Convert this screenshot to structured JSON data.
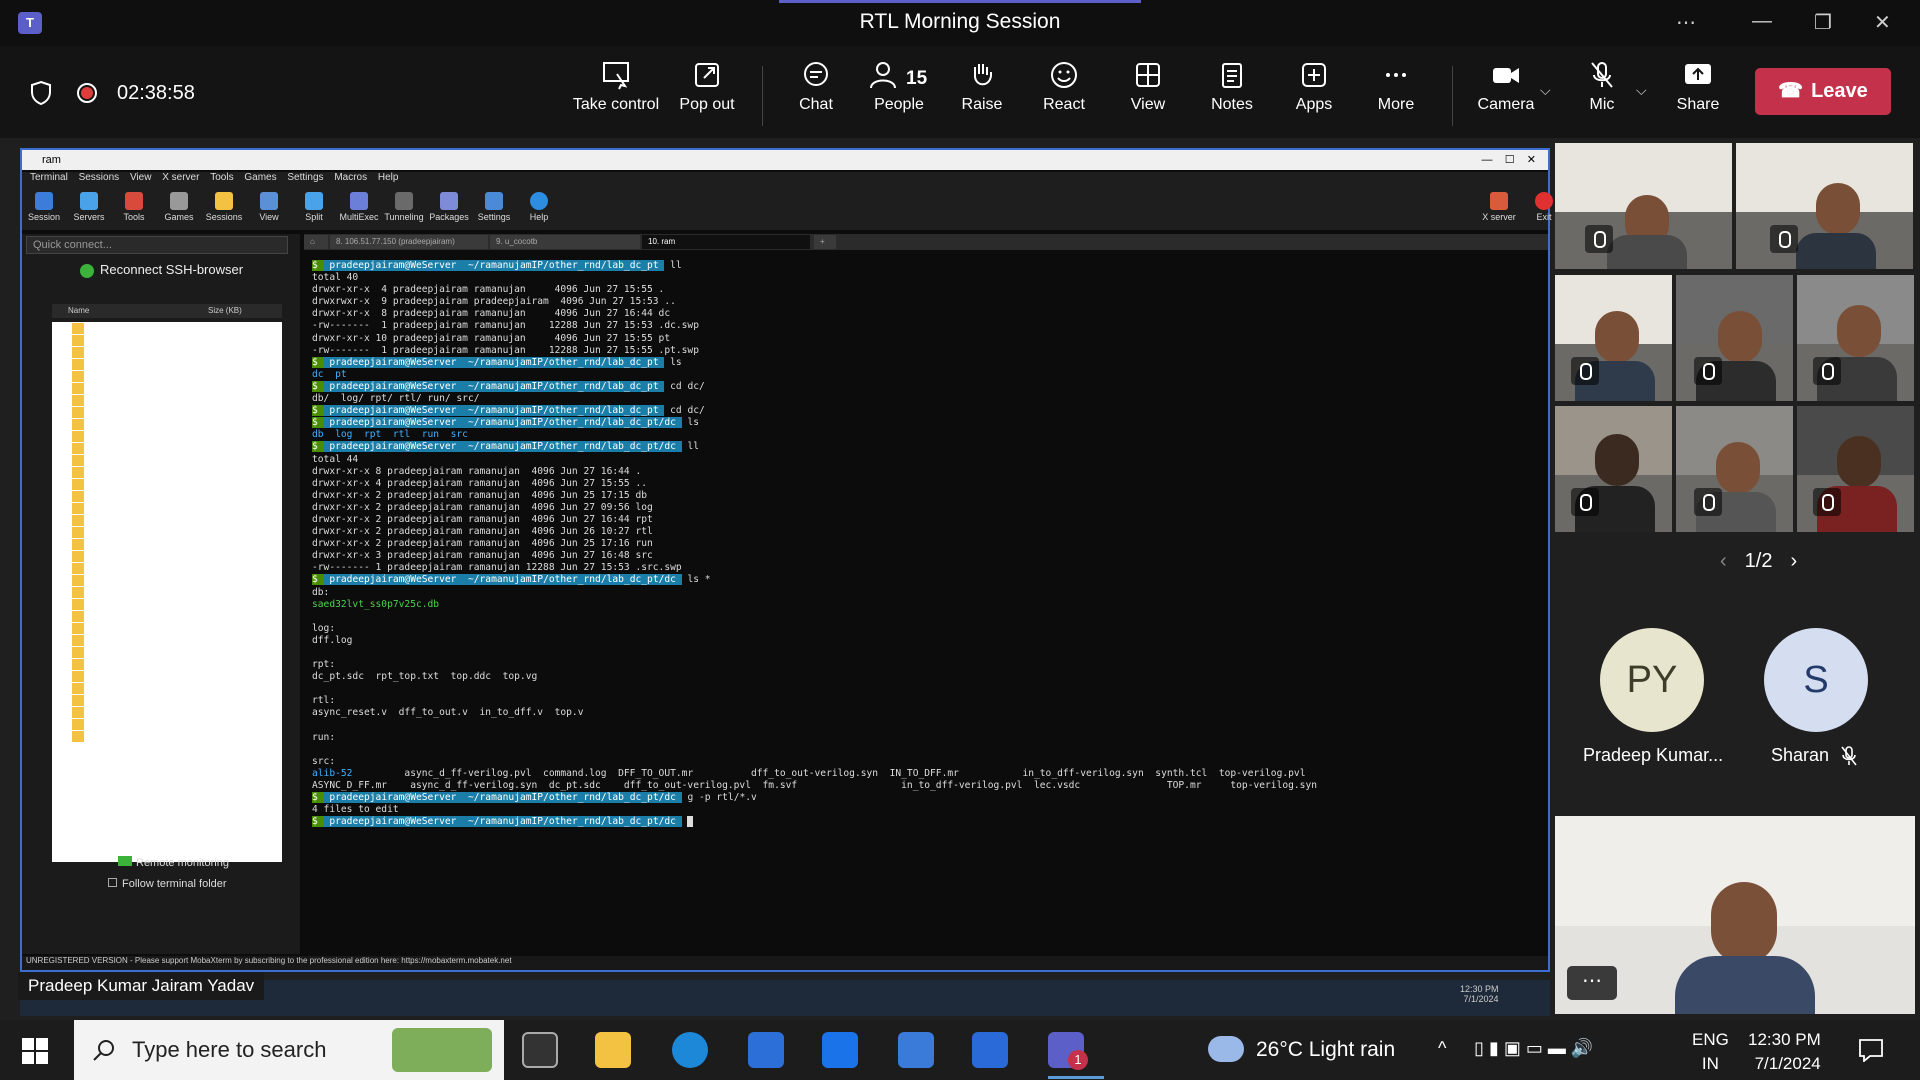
{
  "window": {
    "title": "RTL Morning Session"
  },
  "toolbar": {
    "timer": "02:38:58",
    "take_control": "Take control",
    "pop_out": "Pop out",
    "chat": "Chat",
    "people": "People",
    "people_count": "15",
    "raise": "Raise",
    "react": "React",
    "view": "View",
    "notes": "Notes",
    "apps": "Apps",
    "more": "More",
    "camera": "Camera",
    "mic": "Mic",
    "share": "Share",
    "leave": "Leave"
  },
  "shared_screen": {
    "window_title": "ram",
    "menu": [
      "Terminal",
      "Sessions",
      "View",
      "X server",
      "Tools",
      "Games",
      "Settings",
      "Macros",
      "Help"
    ],
    "tools": [
      "Session",
      "Servers",
      "Tools",
      "Games",
      "Sessions",
      "View",
      "Split",
      "MultiExec",
      "Tunneling",
      "Packages",
      "Settings",
      "Help"
    ],
    "xserver": "X server",
    "exit": "Exit",
    "quick_connect": "Quick connect...",
    "reconnect": "Reconnect SSH-browser",
    "col_name": "Name",
    "col_size": "Size (KB)",
    "remote_monitoring": "Remote monitoring",
    "follow_folder": "Follow terminal folder",
    "tabs": [
      "8. 106.51.77.150 (pradeepjairam)",
      "9. u_cocotb",
      "10. ram"
    ],
    "unregistered": "UNREGISTERED VERSION  -  Please support MobaXterm by subscribing to the professional edition here:  https://mobaxterm.mobatek.net",
    "terminal": {
      "prompt_user": "pradeepjairam@WeServer",
      "path1": "~/ramanujamIP/other_rnd/lab_dc_pt",
      "path2": "~/ramanujamIP/other_rnd/lab_dc_pt/dc",
      "cmd_ll": "ll",
      "cmd_ls": "ls",
      "cmd_cd": "cd dc/",
      "cmd_lsstar": "ls *",
      "cmd_g": "g -p rtl/*.v",
      "total40": "total 40",
      "ll1": [
        "drwxr-xr-x  4 pradeepjairam ramanujan     4096 Jun 27 15:55 .",
        "drwxrwxr-x  9 pradeepjairam pradeepjairam  4096 Jun 27 15:53 ..",
        "drwxr-xr-x  8 pradeepjairam ramanujan     4096 Jun 27 16:44 dc",
        "-rw-------  1 pradeepjairam ramanujan    12288 Jun 27 15:53 .dc.swp",
        "drwxr-xr-x 10 pradeepjairam ramanujan     4096 Jun 27 15:55 pt",
        "-rw-------  1 pradeepjairam ramanujan    12288 Jun 27 15:55 .pt.swp"
      ],
      "ls1": "dc  pt",
      "cd_out": "db/  log/ rpt/ rtl/ run/ src/",
      "ls2": "db  log  rpt  rtl  run  src",
      "total44": "total 44",
      "ll2": [
        "drwxr-xr-x 8 pradeepjairam ramanujan  4096 Jun 27 16:44 .",
        "drwxr-xr-x 4 pradeepjairam ramanujan  4096 Jun 27 15:55 ..",
        "drwxr-xr-x 2 pradeepjairam ramanujan  4096 Jun 25 17:15 db",
        "drwxr-xr-x 2 pradeepjairam ramanujan  4096 Jun 27 09:56 log",
        "drwxr-xr-x 2 pradeepjairam ramanujan  4096 Jun 27 16:44 rpt",
        "drwxr-xr-x 2 pradeepjairam ramanujan  4096 Jun 26 10:27 rtl",
        "drwxr-xr-x 2 pradeepjairam ramanujan  4096 Jun 25 17:16 run",
        "drwxr-xr-x 3 pradeepjairam ramanujan  4096 Jun 27 16:48 src",
        "-rw------- 1 pradeepjairam ramanujan 12288 Jun 27 15:53 .src.swp"
      ],
      "db_h": "db:",
      "db_f": "saed32lvt_ss0p7v25c.db",
      "log_h": "log:",
      "log_f": "dff.log",
      "rpt_h": "rpt:",
      "rpt_f": "dc_pt.sdc  rpt_top.txt  top.ddc  top.vg",
      "rtl_h": "rtl:",
      "rtl_f": "async_reset.v  dff_to_out.v  in_to_dff.v  top.v",
      "run_h": "run:",
      "src_h": "src:",
      "src_1a": "alib-52",
      "src_1b": "         async_d_ff-verilog.pvl  command.log  DFF_TO_OUT.mr          dff_to_out-verilog.syn  IN_TO_DFF.mr           in_to_dff-verilog.syn  synth.tcl  top-verilog.pvl",
      "src_2": "ASYNC_D_FF.mr    async_d_ff-verilog.syn  dc_pt.sdc    dff_to_out-verilog.pvl  fm.svf                  in_to_dff-verilog.pvl  lec.vsdc               TOP.mr     top-verilog.syn",
      "g_out": "4 files to edit"
    }
  },
  "presenter_name": "Pradeep Kumar Jairam Yadav",
  "pager": "1/2",
  "participants": [
    {
      "initials": "PY",
      "name": "Pradeep Kumar...",
      "color": "#e8e5cf",
      "text_color": "#3d3d2a"
    },
    {
      "initials": "S",
      "name": "Sharan",
      "color": "#d4def0",
      "text_color": "#243a6a"
    }
  ],
  "taskbar": {
    "search_placeholder": "Type here to search",
    "weather": "26°C  Light rain",
    "lang1": "ENG",
    "lang2": "IN",
    "time": "12:30 PM",
    "date": "7/1/2024",
    "inner_time": "12:30 PM",
    "inner_date": "7/1/2024",
    "teams_badge": "1"
  }
}
